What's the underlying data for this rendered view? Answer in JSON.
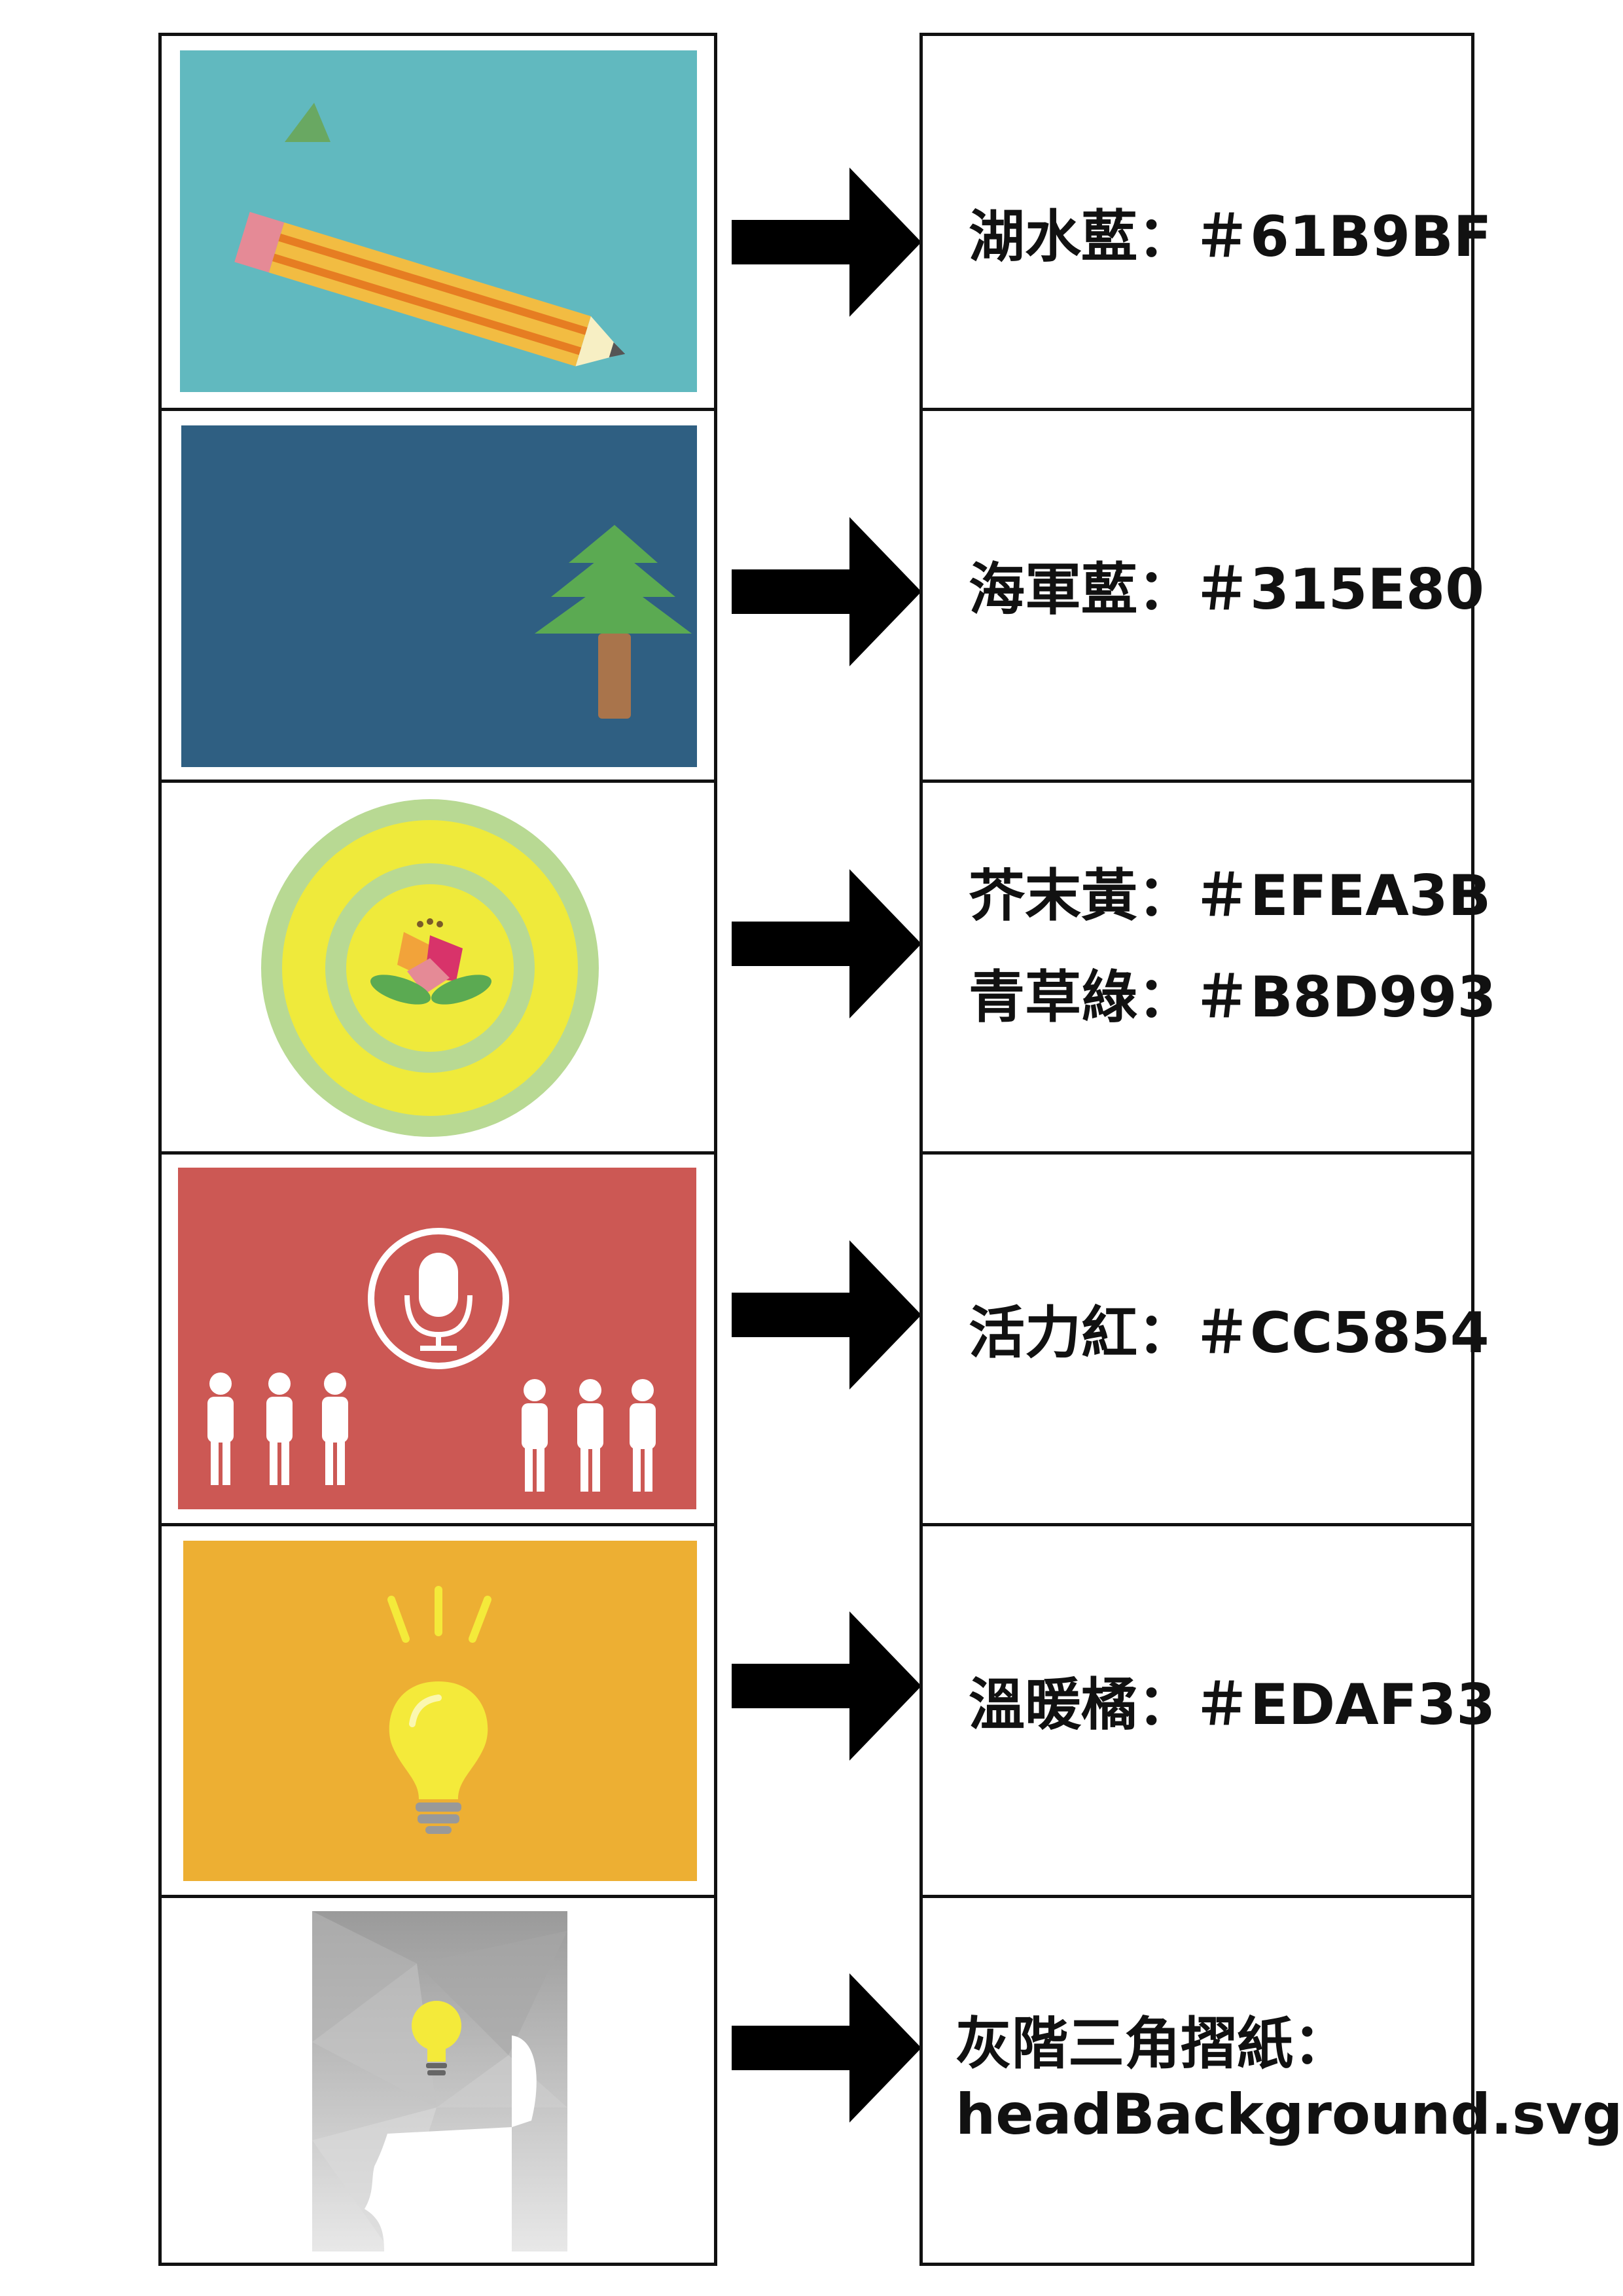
{
  "rows": [
    {
      "name": "湖水藍",
      "sep": "：",
      "value": "＃61B9BF",
      "color": "#61B9BF"
    },
    {
      "name": "海軍藍",
      "sep": "：",
      "value": "＃315E80",
      "color": "#315E80"
    },
    {
      "items": [
        {
          "name": "芥末黃",
          "sep": "：",
          "value": "＃EFEA3B",
          "color": "#EFEA3B"
        },
        {
          "name": "青草綠",
          "sep": "：",
          "value": "＃B8D993",
          "color": "#B8D993"
        }
      ]
    },
    {
      "name": "活力紅",
      "sep": "：",
      "value": "＃CC5854",
      "color": "#CC5854"
    },
    {
      "name": "溫暖橘",
      "sep": "：",
      "value": "＃EDAF33",
      "color": "#EDAF33"
    },
    {
      "name": "灰階三角摺紙",
      "sep": "：",
      "value": "headBackground.svg"
    }
  ],
  "icons": [
    "pencil-icon",
    "tree-icon",
    "flower-target-icon",
    "microphone-icon",
    "people-icon",
    "lightbulb-icon",
    "head-icon"
  ]
}
